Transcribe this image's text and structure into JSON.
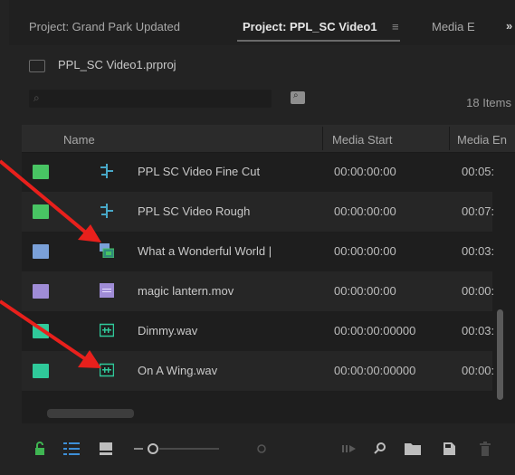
{
  "tabs": [
    {
      "label": "Project: Grand Park Updated",
      "active": false
    },
    {
      "label": "Project: PPL_SC Video1",
      "active": true
    },
    {
      "label": "Media E",
      "active": false
    }
  ],
  "tab_menu_glyph": "≡",
  "tab_overflow_glyph": "»",
  "project_file": "PPL_SC Video1.prproj",
  "search": {
    "placeholder": "",
    "value": ""
  },
  "items_count": "18 Items",
  "columns": [
    "Name",
    "Media Start",
    "Media En"
  ],
  "rows": [
    {
      "name": "PPL SC Video Fine Cut",
      "media_start": "00:00:00:00",
      "media_end": "00:05:",
      "label_color": "#48c463",
      "icon": "sequence-icon"
    },
    {
      "name": "PPL SC Video Rough",
      "media_start": "00:00:00:00",
      "media_end": "00:07:",
      "label_color": "#48c463",
      "icon": "sequence-icon"
    },
    {
      "name": "What a Wonderful World |",
      "media_start": "00:00:00:00",
      "media_end": "00:03:",
      "label_color": "#7aa0d8",
      "icon": "multicam-clip-icon"
    },
    {
      "name": "magic lantern.mov",
      "media_start": "00:00:00:00",
      "media_end": "00:00:",
      "label_color": "#9f8cd6",
      "icon": "video-clip-icon"
    },
    {
      "name": "Dimmy.wav",
      "media_start": "00:00:00:00000",
      "media_end": "00:03:",
      "label_color": "#2fc99a",
      "icon": "audio-clip-icon"
    },
    {
      "name": "On A Wing.wav",
      "media_start": "00:00:00:00000",
      "media_end": "00:00:",
      "label_color": "#2fc99a",
      "icon": "audio-clip-icon"
    }
  ],
  "colors": {
    "annotation_arrow": "#e8201c",
    "accent_green": "#3fb552",
    "active_icon": "#3d8fd8"
  }
}
